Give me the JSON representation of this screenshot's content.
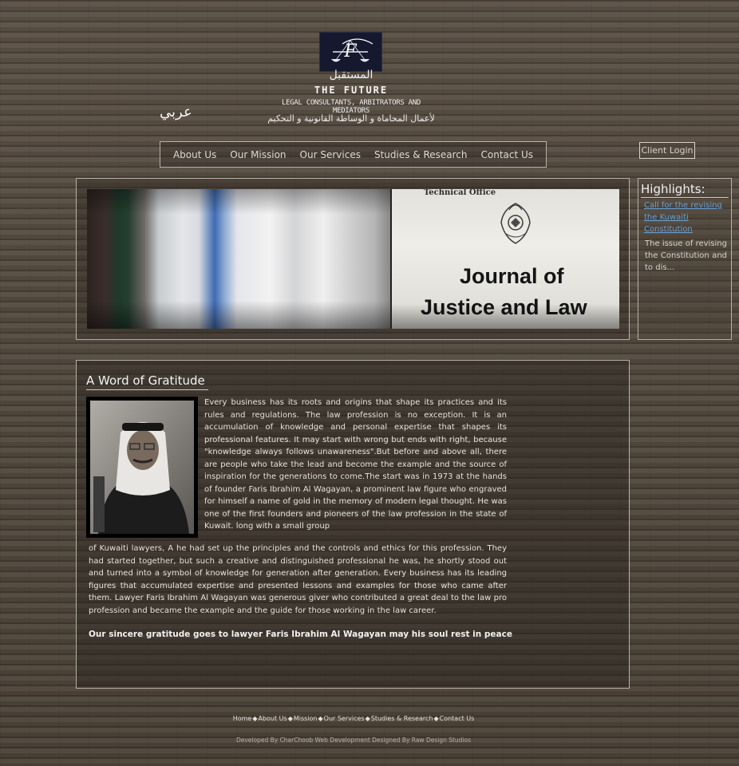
{
  "header": {
    "logo_arabic": "المستقبل",
    "logo_name": "THE FUTURE",
    "logo_tagline": "LEGAL CONSULTANTS, ARBITRATORS AND MEDIATORS",
    "logo_tagline_arabic": "لأعمال المحاماة و الوساطة القانونية و التحكيم",
    "lang_switch": "عربي"
  },
  "nav": {
    "items": [
      "About Us",
      "Our Mission",
      "Our Services",
      "Studies & Research",
      "Contact Us"
    ]
  },
  "client_login": "Client Login",
  "banner": {
    "technical_office": "Technical Office",
    "journal_line1": "Journal of",
    "journal_line2": "Justice and Law"
  },
  "highlights": {
    "title": "Highlights:",
    "link": "Call for the revising the Kuwaiti Constitution",
    "excerpt": "The issue of revising the Constitution and to dis..."
  },
  "article": {
    "title": "A Word of Gratitude",
    "para1": "Every business has its roots and origins that shape its practices and its rules and regulations. The law profession is no exception. It is an accumulation of knowledge and personal expertise that shapes its professional features. It may start with wrong but ends with right, because \"knowledge always follows unawareness\".But before and above all, there are people who take the lead and become the example and the source of inspiration for the generations to come.The start was in 1973 at the hands of founder Faris Ibrahim Al Wagayan, a prominent law figure who engraved for himself a name of gold in the memory of modern legal thought. He was one of the first founders and pioneers of the law profession in the state of Kuwait. long with a small group",
    "para2": "of Kuwaiti lawyers, A he had set up the principles and the controls and ethics for this profession. They had started together, but such a creative and distinguished professional he was, he shortly stood out and turned into a symbol of knowledge for generation after generation. Every business has its leading figures that accumulated expertise and presented lessons and examples for those who came after them. Lawyer Faris Ibrahim Al Wagayan was generous giver who contributed a great deal to the law pro profession and became the example and the guide for those working in the law career.",
    "gratitude": "Our sincere gratitude goes to lawyer Faris Ibrahim Al Wagayan may his soul rest in peace"
  },
  "footer": {
    "links": [
      "Home",
      "About Us",
      "Mission",
      "Our Services",
      "Studies & Research",
      "Contact Us"
    ],
    "separator": "◆",
    "credit": "Developed By CharChoob Web Development Designed By Raw Design Studios"
  },
  "colors": {
    "link_blue": "#6aa0d4",
    "border": "#b8b2a6",
    "logo_bg": "#15182e"
  }
}
